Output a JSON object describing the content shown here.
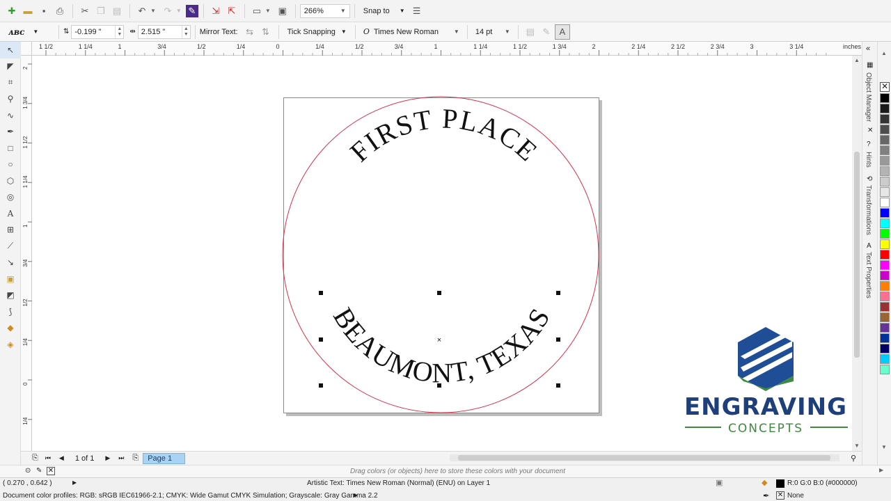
{
  "standard_toolbar": {
    "zoom": "266%",
    "snap_to": "Snap to"
  },
  "property_bar": {
    "offset_distance": "-0.199 \"",
    "offset_from_path": "2.515 \"",
    "mirror_text_label": "Mirror Text:",
    "tick_snapping": "Tick Snapping",
    "font_name": "Times New Roman",
    "font_size": "14 pt"
  },
  "rulers": {
    "units": "inches",
    "horizontal_labels": [
      "1 1/2",
      "1 1/4",
      "1",
      "3/4",
      "1/2",
      "1/4",
      "0",
      "1/4",
      "1/2",
      "3/4",
      "1",
      "1 1/4",
      "1 1/2",
      "1 3/4",
      "2",
      "2 1/4",
      "2 1/2",
      "2 3/4",
      "3",
      "3 1/4"
    ],
    "vertical_labels": [
      "2",
      "1 3/4",
      "1 1/2",
      "1 1/4",
      "1",
      "3/4",
      "1/2",
      "1/4",
      "0",
      "1/4"
    ]
  },
  "artwork": {
    "top_text": "FIRST PLACE",
    "bottom_text": "BEAUMONT, TEXAS",
    "circle_color": "#d9304a"
  },
  "logo": {
    "line1": "ENGRAVING",
    "line2": "CONCEPTS",
    "blue": "#1f4e96",
    "green": "#3d8b3d"
  },
  "dockers": {
    "object_manager": "Object Manager",
    "hints": "Hints",
    "transformations": "Transformations",
    "text_properties": "Text Properties"
  },
  "palette_colors": [
    "#000000",
    "#1a1a1a",
    "#333333",
    "#4d4d4d",
    "#666666",
    "#808080",
    "#999999",
    "#b3b3b3",
    "#cccccc",
    "#e6e6e6",
    "#ffffff",
    "#0000ff",
    "#00ffff",
    "#00ff00",
    "#ffff00",
    "#ff0000",
    "#ff00ff",
    "#cc00cc",
    "#ff7f00",
    "#ff6f91",
    "#993333",
    "#996633",
    "#663399",
    "#003399",
    "#000066",
    "#00ccff",
    "#66ffcc"
  ],
  "navigation": {
    "page_count": "1 of 1",
    "page_tab": "Page 1"
  },
  "document_palette_hint": "Drag colors (or objects) here to store these colors with your document",
  "status": {
    "coordinates": "( 0.270 , 0.642 )",
    "object_info": "Artistic Text: Times New Roman (Normal) (ENU) on Layer 1",
    "fill": "R:0 G:0 B:0 (#000000)",
    "outline": "None",
    "color_profiles": "Document color profiles: RGB: sRGB IEC61966-2.1; CMYK: Wide Gamut CMYK Simulation; Grayscale: Gray Gamma 2.2"
  }
}
